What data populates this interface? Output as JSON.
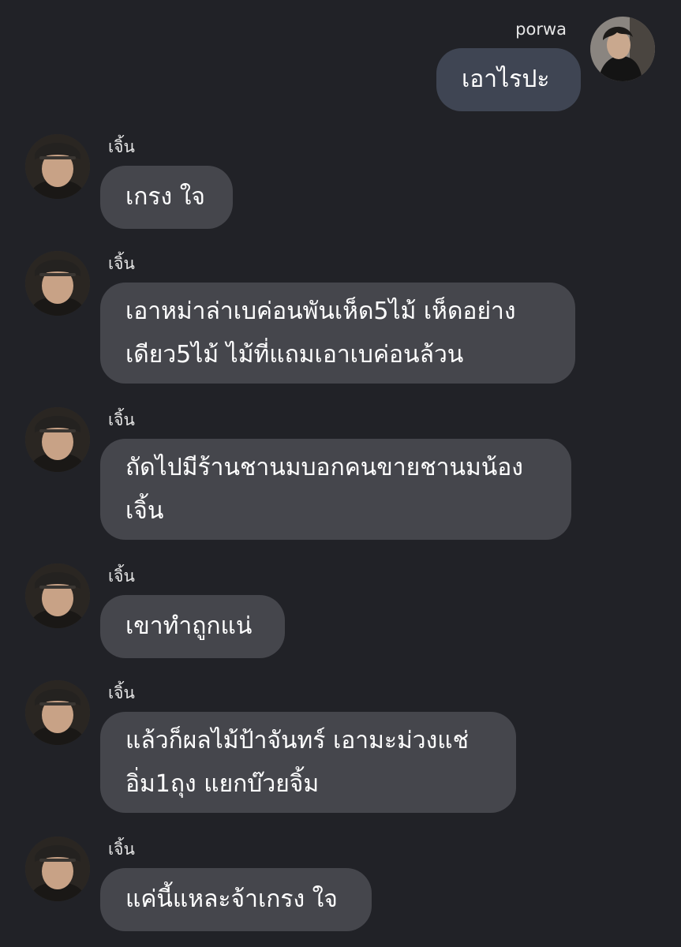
{
  "conversation": {
    "outgoing": {
      "sender": "porwa",
      "text": "เอาไรปะ"
    },
    "incoming_sender": "เจิ้น",
    "messages": [
      {
        "lines": [
          "เกรง ใจ"
        ]
      },
      {
        "lines": [
          "เอาหม่าล่าเบค่อนพันเห็ด5ไม้ เห็ดอย่าง",
          "เดียว5ไม้ ไม้ที่แถมเอาเบค่อนล้วน"
        ]
      },
      {
        "lines": [
          "ถัดไปมีร้านชานมบอกคนขายชานมน้อง",
          "เจิ้น"
        ]
      },
      {
        "lines": [
          "เขาทำถูกแน่"
        ]
      },
      {
        "lines": [
          "แล้วก็ผลไม้ป้าจันทร์ เอามะม่วงแช่",
          "อิ่ม1ถุง แยกบ๊วยจิ้ม"
        ]
      },
      {
        "lines": [
          "แค่นี้แหละจ้าเกรง ใจ"
        ]
      }
    ]
  }
}
